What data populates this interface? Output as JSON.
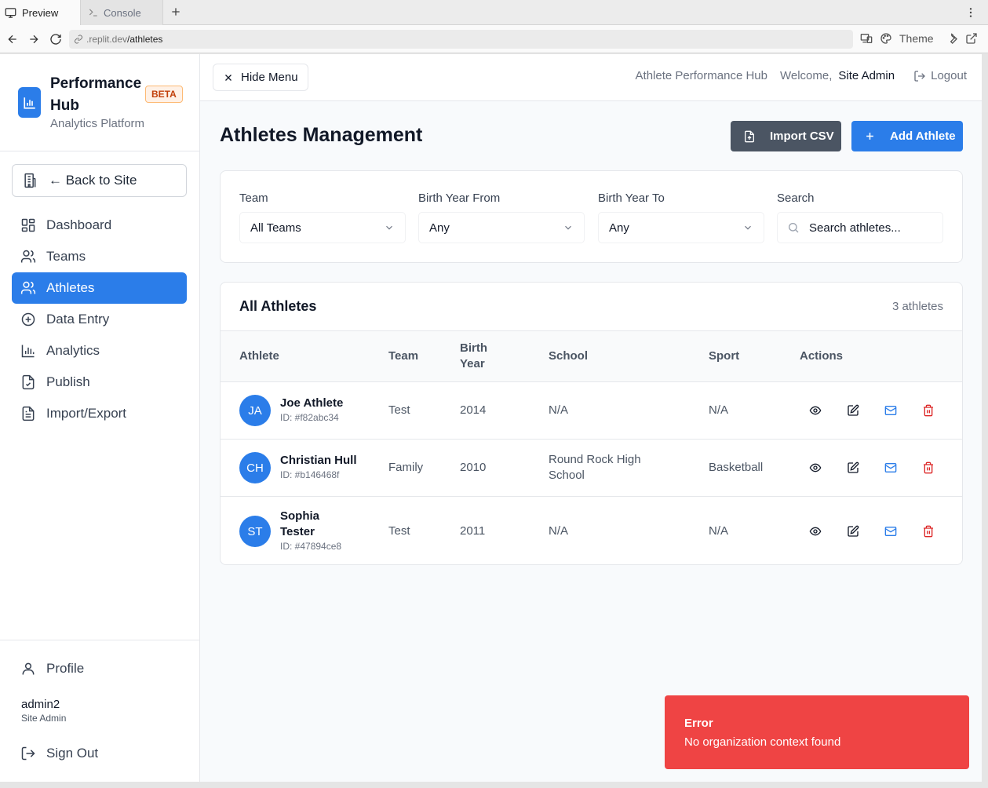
{
  "browser": {
    "tabs": [
      {
        "label": "Preview",
        "icon": "monitor-icon"
      },
      {
        "label": "Console",
        "icon": "terminal-icon"
      }
    ],
    "url_host": ".replit.dev",
    "url_path": "/athletes",
    "theme_label": "Theme"
  },
  "sidebar": {
    "brand_title": "Performance Hub",
    "brand_subtitle": "Analytics Platform",
    "beta_badge": "BETA",
    "back_label": "← Back to Site",
    "items": [
      {
        "label": "Dashboard",
        "icon": "dashboard-grid-icon",
        "active": false
      },
      {
        "label": "Teams",
        "icon": "users-icon",
        "active": false
      },
      {
        "label": "Athletes",
        "icon": "users-icon",
        "active": true
      },
      {
        "label": "Data Entry",
        "icon": "plus-circle-icon",
        "active": false
      },
      {
        "label": "Analytics",
        "icon": "bar-chart-icon",
        "active": false
      },
      {
        "label": "Publish",
        "icon": "file-check-icon",
        "active": false
      },
      {
        "label": "Import/Export",
        "icon": "file-text-icon",
        "active": false
      }
    ],
    "profile_label": "Profile",
    "user_name": "admin2",
    "user_role": "Site Admin",
    "signout_label": "Sign Out"
  },
  "header": {
    "hide_menu_label": "Hide Menu",
    "app_name": "Athlete Performance Hub",
    "welcome": "Welcome,",
    "user": "Site Admin",
    "logout_label": "Logout"
  },
  "main": {
    "title": "Athletes Management",
    "import_label": "Import CSV",
    "add_label": "Add Athlete",
    "filters": {
      "team_label": "Team",
      "team_value": "All Teams",
      "from_label": "Birth Year From",
      "from_value": "Any",
      "to_label": "Birth Year To",
      "to_value": "Any",
      "search_label": "Search",
      "search_placeholder": "Search athletes..."
    },
    "table": {
      "title": "All Athletes",
      "count": "3 athletes",
      "columns": {
        "athlete": "Athlete",
        "team": "Team",
        "birth_year_1": "Birth",
        "birth_year_2": "Year",
        "school": "School",
        "sport": "Sport",
        "actions": "Actions"
      },
      "rows": [
        {
          "initials": "JA",
          "name": "Joe Athlete",
          "id": "ID: #f82abc34",
          "team": "Test",
          "birth_year": "2014",
          "school": "N/A",
          "sport": "N/A"
        },
        {
          "initials": "CH",
          "name": "Christian Hull",
          "id": "ID: #b146468f",
          "team": "Family",
          "birth_year": "2010",
          "school": "Round Rock High School",
          "sport": "Basketball"
        },
        {
          "initials": "ST",
          "name": "Sophia Tester",
          "id": "ID: #47894ce8",
          "team": "Test",
          "birth_year": "2011",
          "school": "N/A",
          "sport": "N/A"
        }
      ]
    }
  },
  "toast": {
    "title": "Error",
    "message": "No organization context found"
  },
  "colors": {
    "accent": "#2b7de9",
    "danger": "#ef4444",
    "import_button": "#4b5563"
  }
}
